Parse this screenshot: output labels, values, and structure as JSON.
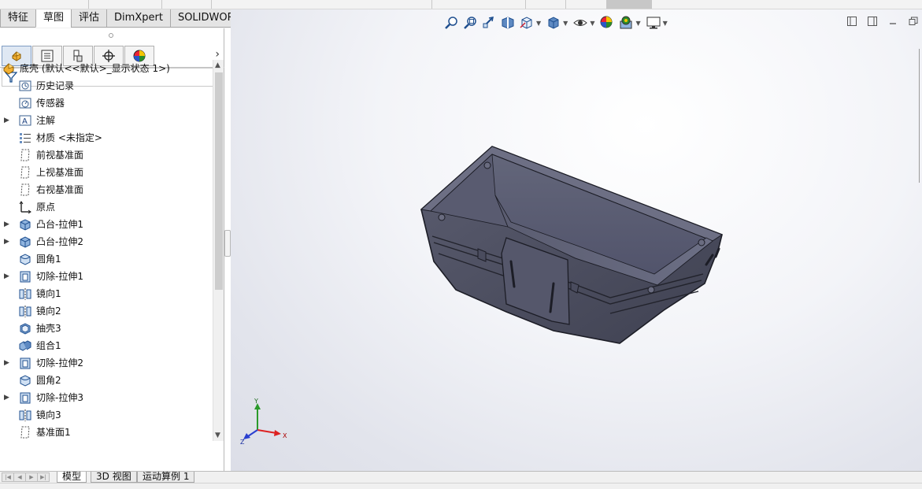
{
  "command_tabs": [
    {
      "label": "特征",
      "active": false
    },
    {
      "label": "草图",
      "active": true
    },
    {
      "label": "评估",
      "active": false
    },
    {
      "label": "DimXpert",
      "active": false
    },
    {
      "label": "SOLIDWORKS 插件",
      "active": false
    }
  ],
  "panel_tabs": [
    {
      "icon": "feature-manager-icon",
      "active": true
    },
    {
      "icon": "property-manager-icon",
      "active": false
    },
    {
      "icon": "configuration-manager-icon",
      "active": false
    },
    {
      "icon": "dimxpert-manager-icon",
      "active": false
    },
    {
      "icon": "display-manager-icon",
      "active": false
    }
  ],
  "tree": {
    "root": "底壳  (默认<<默认>_显示状态 1>)",
    "items": [
      {
        "label": "历史记录",
        "icon": "history-icon",
        "expandable": false
      },
      {
        "label": "传感器",
        "icon": "sensor-icon",
        "expandable": false
      },
      {
        "label": "注解",
        "icon": "annotation-icon",
        "expandable": true
      },
      {
        "label": "材质 <未指定>",
        "icon": "material-icon",
        "expandable": false
      },
      {
        "label": "前视基准面",
        "icon": "plane-icon",
        "expandable": false
      },
      {
        "label": "上视基准面",
        "icon": "plane-icon",
        "expandable": false
      },
      {
        "label": "右视基准面",
        "icon": "plane-icon",
        "expandable": false
      },
      {
        "label": "原点",
        "icon": "origin-icon",
        "expandable": false
      },
      {
        "label": "凸台-拉伸1",
        "icon": "boss-extrude-icon",
        "expandable": true
      },
      {
        "label": "凸台-拉伸2",
        "icon": "boss-extrude-icon",
        "expandable": true
      },
      {
        "label": "圆角1",
        "icon": "fillet-icon",
        "expandable": false
      },
      {
        "label": "切除-拉伸1",
        "icon": "cut-extrude-icon",
        "expandable": true
      },
      {
        "label": "镜向1",
        "icon": "mirror-icon",
        "expandable": false
      },
      {
        "label": "镜向2",
        "icon": "mirror-icon",
        "expandable": false
      },
      {
        "label": "抽壳3",
        "icon": "shell-icon",
        "expandable": false
      },
      {
        "label": "组合1",
        "icon": "combine-icon",
        "expandable": false
      },
      {
        "label": "切除-拉伸2",
        "icon": "cut-extrude-icon",
        "expandable": true
      },
      {
        "label": "圆角2",
        "icon": "fillet-icon",
        "expandable": false
      },
      {
        "label": "切除-拉伸3",
        "icon": "cut-extrude-icon",
        "expandable": true
      },
      {
        "label": "镜向3",
        "icon": "mirror-icon",
        "expandable": false
      },
      {
        "label": "基准面1",
        "icon": "plane-icon",
        "expandable": false
      }
    ]
  },
  "heads_up_toolbar": [
    "zoom-to-fit-icon",
    "zoom-to-area-icon",
    "previous-view-icon",
    "section-view-icon",
    "view-orientation-icon",
    "display-style-icon",
    "hide-show-items-icon",
    "edit-appearance-icon",
    "apply-scene-icon",
    "view-settings-icon"
  ],
  "triad": {
    "x": "X",
    "y": "Y",
    "z": "Z"
  },
  "model_tabs": [
    {
      "label": "模型",
      "active": true
    },
    {
      "label": "3D 视图",
      "active": false
    },
    {
      "label": "运动算例 1",
      "active": false
    }
  ],
  "colors": {
    "model_body": "#4b4d5e",
    "model_edge": "#1c1d26",
    "tab_active_bg": "#ffffff",
    "accent_blue": "#2f6fc0"
  }
}
